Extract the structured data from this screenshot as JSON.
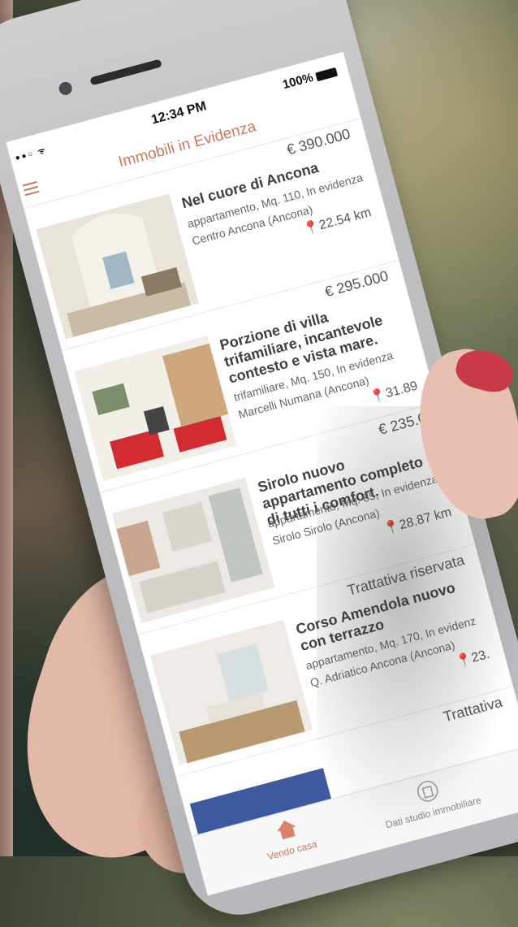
{
  "status_bar": {
    "time": "12:34 PM",
    "battery": "100%"
  },
  "nav": {
    "title": "Immobili in Evidenza"
  },
  "listings": [
    {
      "price": "€ 390.000",
      "title": "Nel cuore di Ancona",
      "meta": "appartamento, Mq. 110, In evidenza",
      "location": "Centro Ancona (Ancona)",
      "distance": "22.54 km"
    },
    {
      "price": "€ 295.000",
      "title": "Porzione di villa trifamiliare, incantevole contesto e vista mare.",
      "meta": "trifamiliare, Mq. 150, In evidenza",
      "location": "Marcelli Numana (Ancona)",
      "distance": "31.89"
    },
    {
      "price": "€ 235.0",
      "title": "Sirolo nuovo appartamento completo di tutti i comfort.",
      "meta": "appartamento, Mq. 85, In evidenza",
      "location": "Sirolo Sirolo (Ancona)",
      "distance": "28.87 km"
    },
    {
      "price": "Trattativa riservata",
      "title": "Corso Amendola nuovo con terrazzo",
      "meta": "appartamento, Mq. 170, In evidenz",
      "location": "Q. Adriatico Ancona (Ancona)",
      "distance": "23."
    },
    {
      "price": "Trattativa"
    }
  ],
  "tabs": [
    {
      "label": "Vendo casa",
      "icon": "house-icon"
    },
    {
      "label": "Dati studio immobiliare",
      "icon": "building-icon"
    }
  ],
  "colors": {
    "accent": "#c9795c",
    "nail": "#c83a4a"
  }
}
